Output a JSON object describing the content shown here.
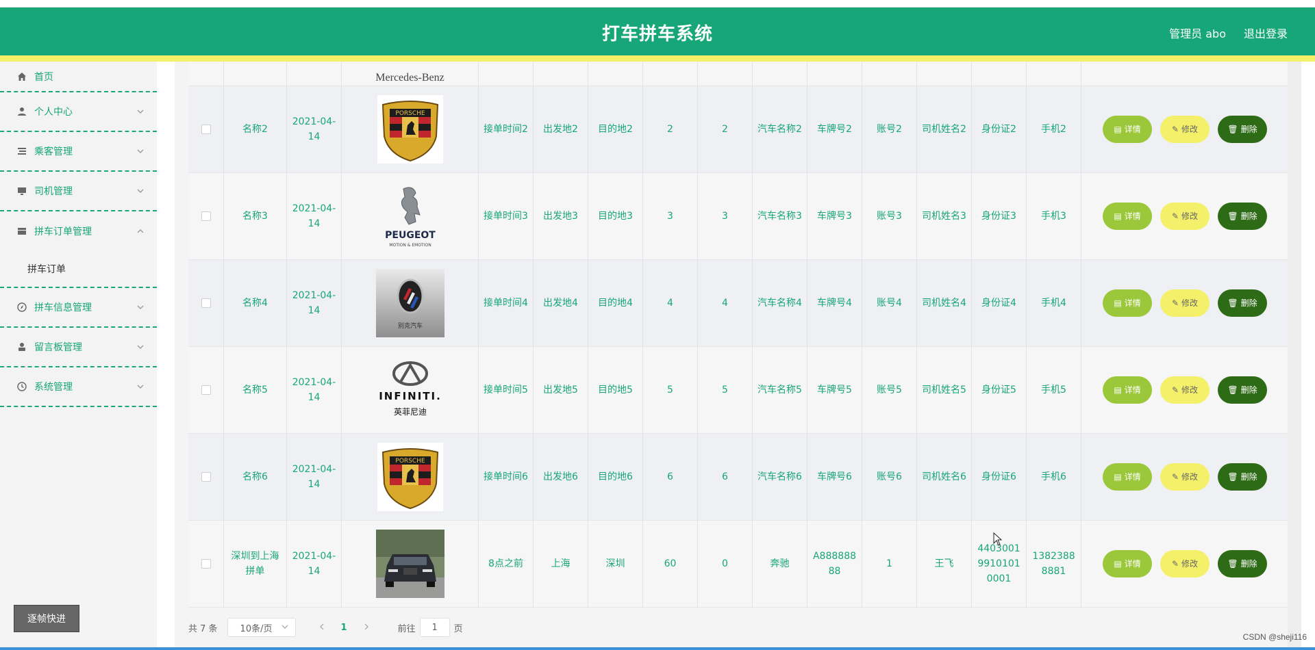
{
  "header": {
    "title": "打车拼车系统",
    "user": "管理员 abo",
    "logout": "退出登录"
  },
  "sidebar": {
    "items": [
      {
        "label": "首页",
        "icon": "home-icon"
      },
      {
        "label": "个人中心",
        "icon": "user-icon"
      },
      {
        "label": "乘客管理",
        "icon": "list-icon"
      },
      {
        "label": "司机管理",
        "icon": "monitor-icon"
      },
      {
        "label": "拼车订单管理",
        "icon": "orders-icon",
        "expanded": true
      },
      {
        "label": "拼车信息管理",
        "icon": "compass-icon"
      },
      {
        "label": "留言板管理",
        "icon": "person-icon"
      },
      {
        "label": "系统管理",
        "icon": "clock-icon"
      }
    ],
    "sub_item": "拼车订单",
    "frame_button": "逐帧快进"
  },
  "table": {
    "partial_top": {
      "logo": "Mercedes-Benz"
    },
    "rows": [
      {
        "name": "名称2",
        "date": "2021-04-14",
        "logo": "PORSCHE",
        "time": "接单时间2",
        "from": "出发地2",
        "to": "目的地2",
        "n1": "2",
        "n2": "2",
        "car": "汽车名称2",
        "plate": "车牌号2",
        "account": "账号2",
        "driver": "司机姓名2",
        "idcard": "身份证2",
        "phone": "手机2"
      },
      {
        "name": "名称3",
        "date": "2021-04-14",
        "logo": "PEUGEOT",
        "logo_sub": "MOTION & EMOTION",
        "time": "接单时间3",
        "from": "出发地3",
        "to": "目的地3",
        "n1": "3",
        "n2": "3",
        "car": "汽车名称3",
        "plate": "车牌号3",
        "account": "账号3",
        "driver": "司机姓名3",
        "idcard": "身份证3",
        "phone": "手机3"
      },
      {
        "name": "名称4",
        "date": "2021-04-14",
        "logo": "别克汽车",
        "time": "接单时间4",
        "from": "出发地4",
        "to": "目的地4",
        "n1": "4",
        "n2": "4",
        "car": "汽车名称4",
        "plate": "车牌号4",
        "account": "账号4",
        "driver": "司机姓名4",
        "idcard": "身份证4",
        "phone": "手机4"
      },
      {
        "name": "名称5",
        "date": "2021-04-14",
        "logo": "INFINITI.",
        "logo_sub": "英菲尼迪",
        "time": "接单时间5",
        "from": "出发地5",
        "to": "目的地5",
        "n1": "5",
        "n2": "5",
        "car": "汽车名称5",
        "plate": "车牌号5",
        "account": "账号5",
        "driver": "司机姓名5",
        "idcard": "身份证5",
        "phone": "手机5"
      },
      {
        "name": "名称6",
        "date": "2021-04-14",
        "logo": "PORSCHE",
        "time": "接单时间6",
        "from": "出发地6",
        "to": "目的地6",
        "n1": "6",
        "n2": "6",
        "car": "汽车名称6",
        "plate": "车牌号6",
        "account": "账号6",
        "driver": "司机姓名6",
        "idcard": "身份证6",
        "phone": "手机6"
      },
      {
        "name": "深圳到上海拼单",
        "date": "2021-04-14",
        "logo": "",
        "time": "8点之前",
        "from": "上海",
        "to": "深圳",
        "n1": "60",
        "n2": "0",
        "car": "奔驰",
        "plate": "A88888888",
        "account": "1",
        "driver": "王飞",
        "idcard": "440300199101010001",
        "phone": "13823888881"
      }
    ],
    "buttons": {
      "detail": "详情",
      "edit": "修改",
      "delete": "删除"
    }
  },
  "pager": {
    "total": "共 7 条",
    "size": "10条/页",
    "current": "1",
    "goto_label": "前往",
    "goto_value": "1",
    "goto_suffix": "页"
  },
  "watermark": "CSDN @sheji116",
  "colors": {
    "primary": "#17a678",
    "yellow": "#f4f06a",
    "detail": "#9bc83a",
    "delete": "#2e6b16"
  }
}
